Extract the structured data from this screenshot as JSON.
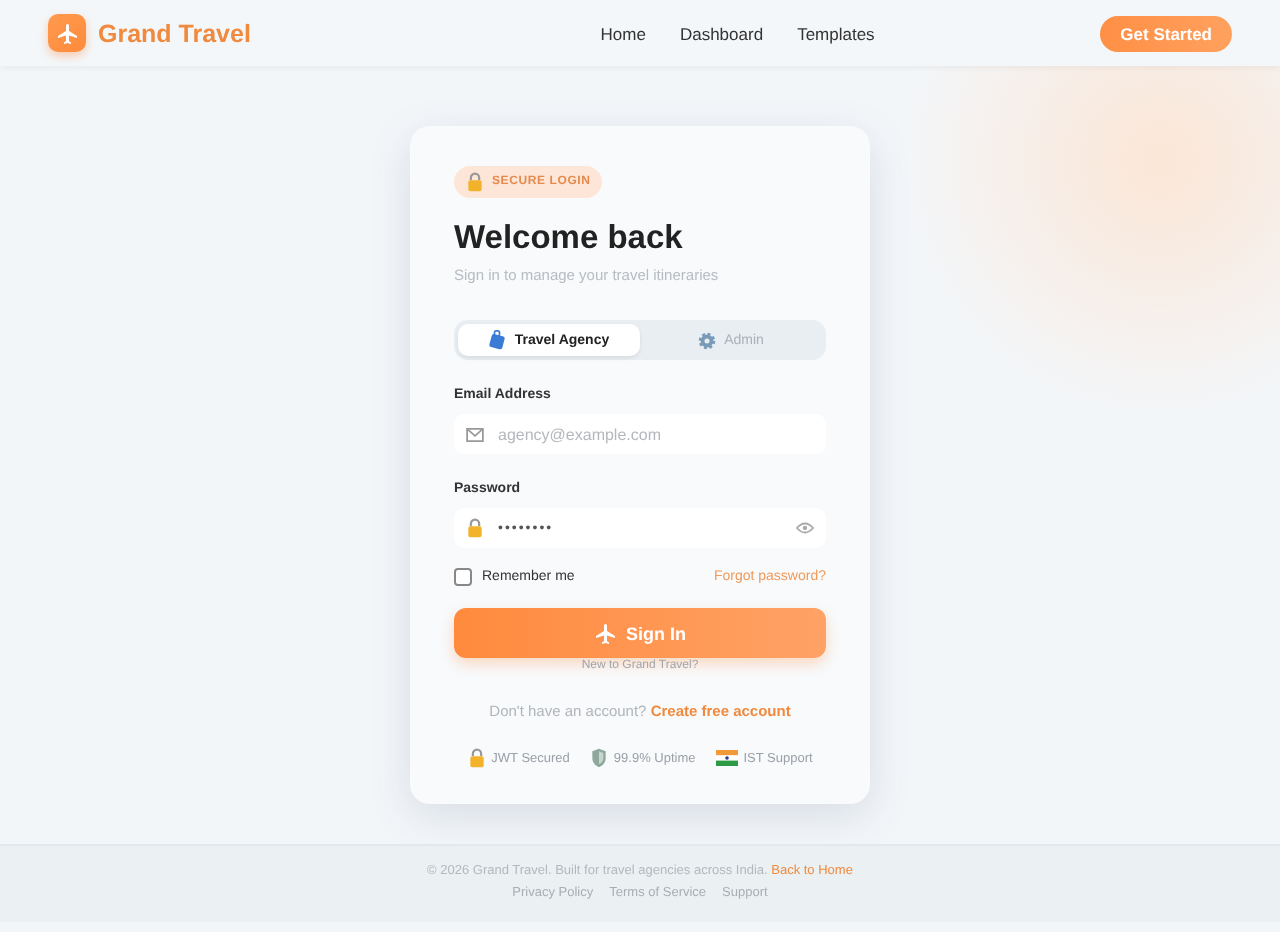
{
  "header": {
    "brand": "Grand Travel",
    "nav": [
      "Home",
      "Dashboard",
      "Templates"
    ],
    "cta": "Get Started"
  },
  "card": {
    "badge": "SECURE LOGIN",
    "title": "Welcome back",
    "subtitle": "Sign in to manage your travel itineraries",
    "tabs": [
      {
        "label": "Travel Agency",
        "kind": "luggage",
        "selected": true
      },
      {
        "label": "Admin",
        "kind": "gear",
        "selected": false
      }
    ],
    "email": {
      "label": "Email Address",
      "placeholder": "agency@example.com"
    },
    "password": {
      "label": "Password",
      "value": "••••••••"
    },
    "remember": {
      "label": "Remember me",
      "checked": false
    },
    "forgot": "Forgot password?",
    "submit": "Sign In",
    "new_note": "New to Grand Travel?",
    "signup": {
      "text": "Don't have an account?",
      "link": "Create free account"
    },
    "trust": [
      {
        "kind": "lock",
        "label": "JWT Secured"
      },
      {
        "kind": "shield",
        "label": "99.9% Uptime"
      },
      {
        "kind": "flag",
        "label": "IST Support"
      }
    ]
  },
  "footer": {
    "text": "© 2026 Grand Travel. Built for travel agencies across India.",
    "link": "Back to Home",
    "links": [
      "Privacy Policy",
      "Terms of Service",
      "Support"
    ]
  }
}
